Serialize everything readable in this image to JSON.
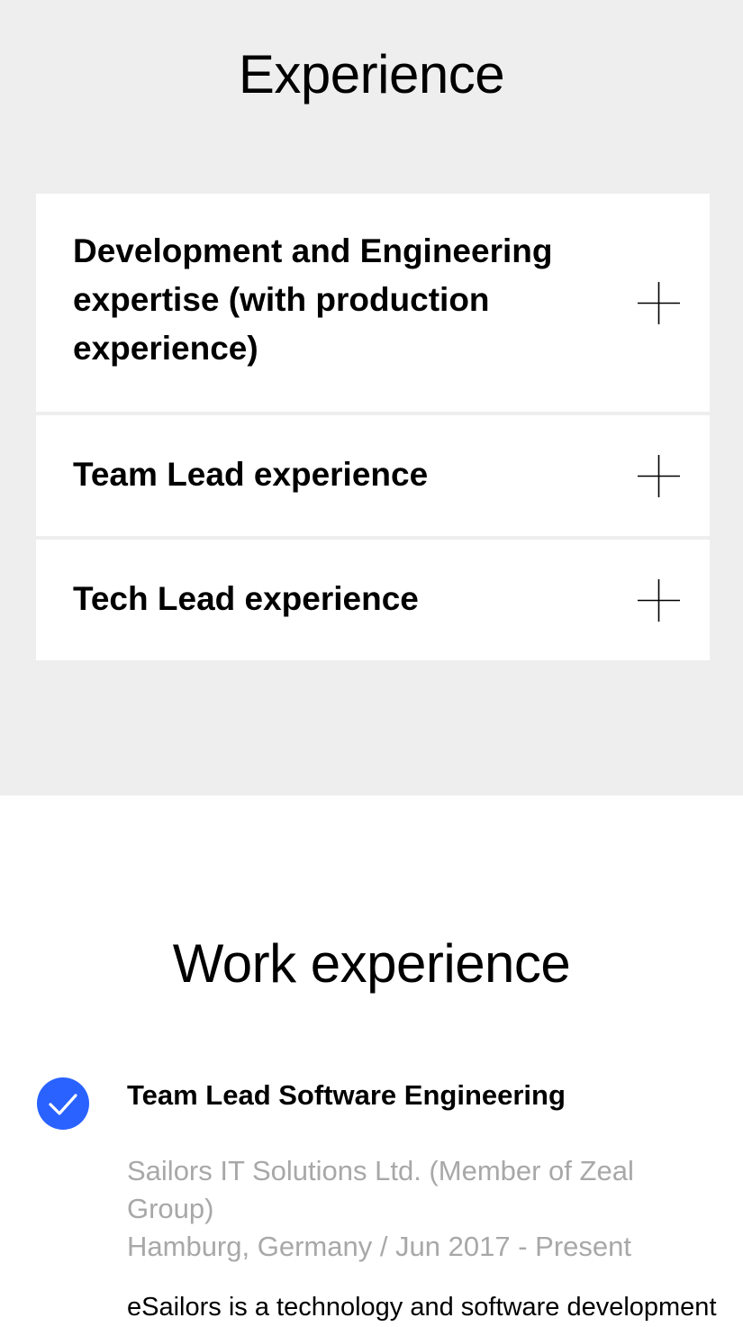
{
  "experience": {
    "title": "Experience",
    "items": [
      {
        "label": "Development and Engineering expertise (with production experience)",
        "icon": "plus-icon"
      },
      {
        "label": "Team Lead experience",
        "icon": "plus-icon"
      },
      {
        "label": "Tech Lead experience",
        "icon": "plus-icon"
      }
    ]
  },
  "work": {
    "title": "Work experience",
    "jobs": [
      {
        "icon": "check-circle-icon",
        "title": "Team Lead Software Engineering",
        "company": "Sailors IT Solutions Ltd. (Member of Zeal Group)",
        "location_dates": "Hamburg, Germany / Jun 2017 - Present",
        "description": "eSailors is a technology and software development"
      }
    ]
  },
  "colors": {
    "section_bg": "#eeeeee",
    "card_bg": "#ffffff",
    "accent": "#2962ff",
    "muted_text": "#a8a8a8"
  }
}
